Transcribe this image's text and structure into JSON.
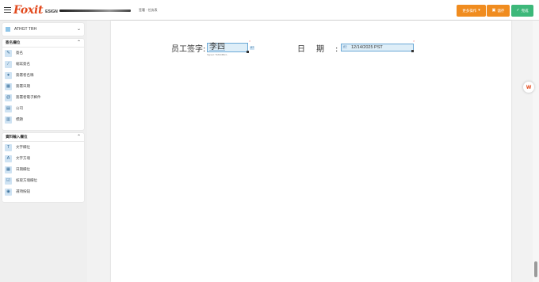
{
  "header": {
    "logo_text": "Foxit",
    "logo_suffix": "ESIGN",
    "doc_name": "签署 · 任务表",
    "buttons": {
      "more": "更多操作",
      "save": "儲存",
      "done": "完成"
    }
  },
  "sidebar": {
    "recipient": {
      "name": "ATHGT TRH",
      "color": "#8fc5e8"
    },
    "signature_panel": {
      "title": "簽名欄位",
      "items": [
        {
          "icon": "pen-icon",
          "label": "簽名"
        },
        {
          "icon": "initials-icon",
          "label": "縮寫簽名"
        },
        {
          "icon": "person-icon",
          "label": "簽署者名稱"
        },
        {
          "icon": "calendar-icon",
          "label": "簽署日期"
        },
        {
          "icon": "at-icon",
          "label": "簽署者電子郵件"
        },
        {
          "icon": "company-icon",
          "label": "公司"
        },
        {
          "icon": "title-icon",
          "label": "標題"
        }
      ]
    },
    "data_panel": {
      "title": "資料輸入欄位",
      "items": [
        {
          "icon": "text-field-icon",
          "label": "文字欄位"
        },
        {
          "icon": "text-box-icon",
          "label": "文字方塊"
        },
        {
          "icon": "date-field-icon",
          "label": "日期欄位"
        },
        {
          "icon": "checkbox-icon",
          "label": "核取方塊欄位"
        },
        {
          "icon": "radio-icon",
          "label": "選項按鈕"
        }
      ]
    }
  },
  "document": {
    "employee_label": "员工签字:",
    "signature_value": "李四",
    "signature_caption": "Signed: T4ZGNBH4...",
    "field_tag": "A?",
    "date_label": "日期:",
    "date_value": "12/14/2025 PST",
    "date_tag": "A?"
  },
  "floating": {
    "label": "W"
  }
}
